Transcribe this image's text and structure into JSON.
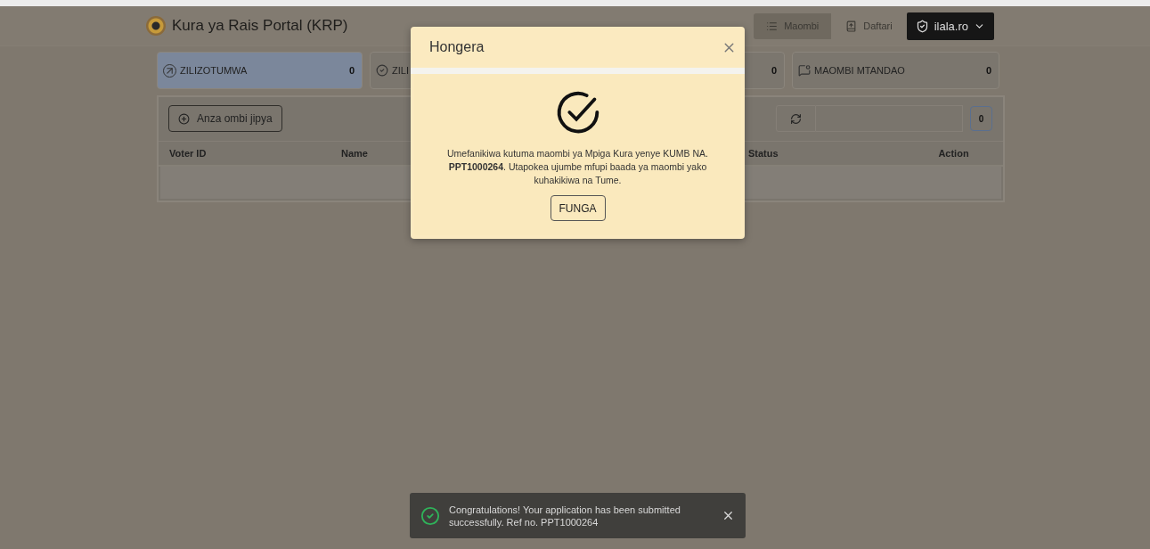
{
  "header": {
    "title": "Kura ya Rais Portal (KRP)",
    "nav": [
      {
        "label": "Maombi",
        "kind": "list",
        "selected": true
      },
      {
        "label": "Daftari",
        "kind": "book",
        "selected": false
      }
    ],
    "user": {
      "label": "ilala.ro"
    }
  },
  "stats": [
    {
      "label": "ZILIZOTUMWA",
      "count": "0",
      "kind": "sent",
      "selected": true
    },
    {
      "label": "ZILI",
      "kind": "done",
      "selected": false
    },
    {
      "count": "0",
      "kind": "none",
      "selected": false
    },
    {
      "label": "MAOMBI MTANDAO",
      "count": "0",
      "kind": "online",
      "selected": false
    }
  ],
  "toolbar": {
    "new_button": "Anza ombi jipya",
    "count": "0"
  },
  "table": {
    "columns": [
      {
        "label": "Voter ID"
      },
      {
        "label": "Name"
      },
      {
        "label": "Status"
      },
      {
        "label": "Action"
      }
    ]
  },
  "modal": {
    "title": "Hongera",
    "message": "Umefanikiwa kutuma maombi ya Mpiga Kura yenye KUMB NA. **PPT1000264**. Utapokea ujumbe mfupi baada ya maombi yako kuhakikiwa na Tume.",
    "button": "FUNGA"
  },
  "toast": {
    "message": "Congratulations! Your application has been submitted successfully. Ref no. PPT1000264"
  }
}
